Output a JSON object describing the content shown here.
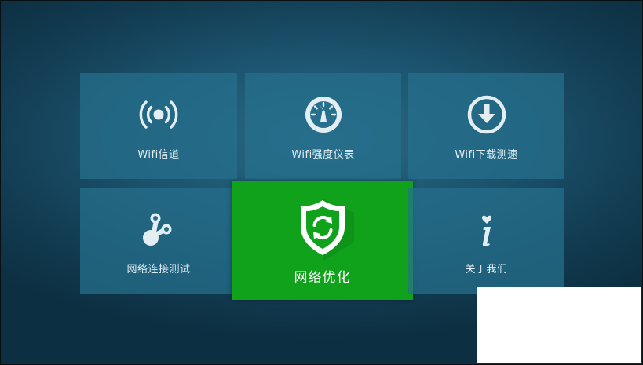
{
  "tiles": {
    "wifi_channel": {
      "label": "Wifi信道",
      "icon": "wifi-signal-icon"
    },
    "wifi_meter": {
      "label": "Wifi强度仪表",
      "icon": "gauge-icon"
    },
    "wifi_speed": {
      "label": "Wifi下载测速",
      "icon": "download-circle-icon"
    },
    "conn_test": {
      "label": "网络连接测试",
      "icon": "connection-nodes-icon"
    },
    "optimize": {
      "label": "网络优化",
      "icon": "shield-refresh-icon"
    },
    "about": {
      "label": "关于我们",
      "icon": "info-icon"
    }
  },
  "colors": {
    "tile_bg": "#26708e",
    "selected_tile_bg": "#11a21c",
    "icon_color": "#e3eef3"
  }
}
